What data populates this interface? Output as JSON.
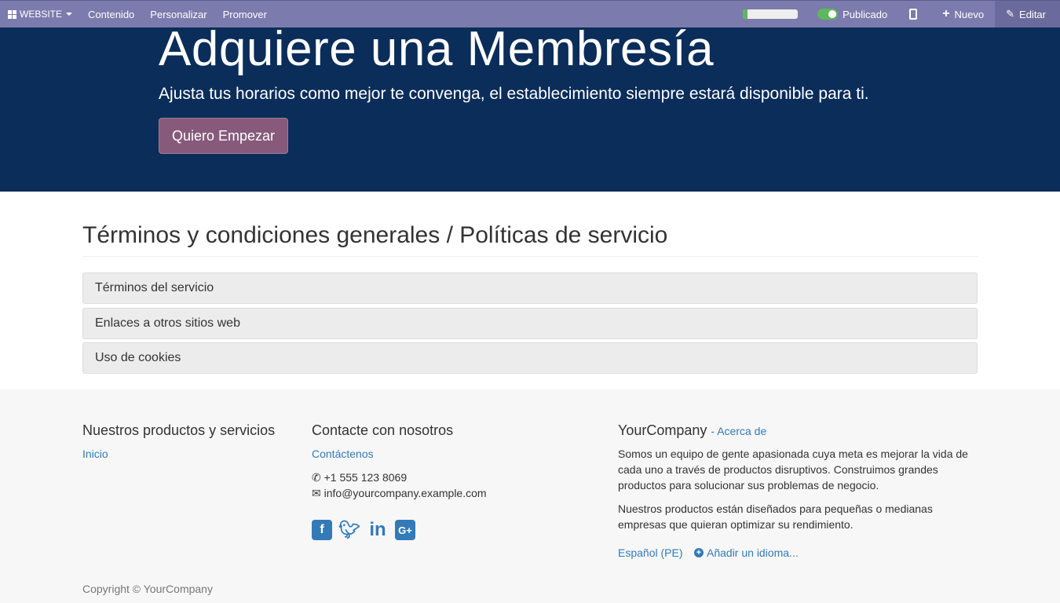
{
  "navbar": {
    "website_label": "WEBSITE",
    "menu_items": [
      "Contenido",
      "Personalizar",
      "Promover"
    ],
    "seo_progress": 0.08,
    "published_label": "Publicado",
    "new_label": "Nuevo",
    "edit_label": "Editar"
  },
  "hero": {
    "title": "Adquiere una Membresía",
    "subtitle": "Ajusta tus horarios como mejor te convenga, el establecimiento siempre estará disponible para ti.",
    "button_label": "Quiero Empezar"
  },
  "terms": {
    "title": "Términos y condiciones generales / Políticas de servicio",
    "panels": [
      "Términos del servicio",
      "Enlaces a otros sitios web",
      "Uso de cookies"
    ]
  },
  "footer": {
    "products_title": "Nuestros productos y servicios",
    "products_link": "Inicio",
    "contact_title": "Contacte con nosotros",
    "contact_link": "Contáctenos",
    "phone": "+1 555 123 8069",
    "email": "info@yourcompany.example.com",
    "company_name": "YourCompany",
    "about_link": "- Acerca de",
    "about_text_1": "Somos un equipo de gente apasionada cuya meta es mejorar la vida de cada uno a través de productos disruptivos. Construimos grandes productos para solucionar sus problemas de negocio.",
    "about_text_2": "Nuestros productos están diseñados para pequeñas o medianas empresas que quieran optimizar su rendimiento.",
    "language": "Español (PE)",
    "add_language": "Añadir un idioma...",
    "copyright": "Copyright © YourCompany"
  },
  "icons": [
    "grid-icon",
    "mobile-icon",
    "plus-icon",
    "pencil-icon",
    "phone-icon",
    "envelope-icon",
    "facebook-icon",
    "twitter-icon",
    "linkedin-icon",
    "google-plus-icon",
    "plus-circle-icon"
  ],
  "colors": {
    "navbar": "#7c7bad",
    "hero_bg": "#0b2d5a",
    "primary_button": "#875a7b",
    "link": "#337ab7",
    "toggle_on": "#5cb85c"
  }
}
